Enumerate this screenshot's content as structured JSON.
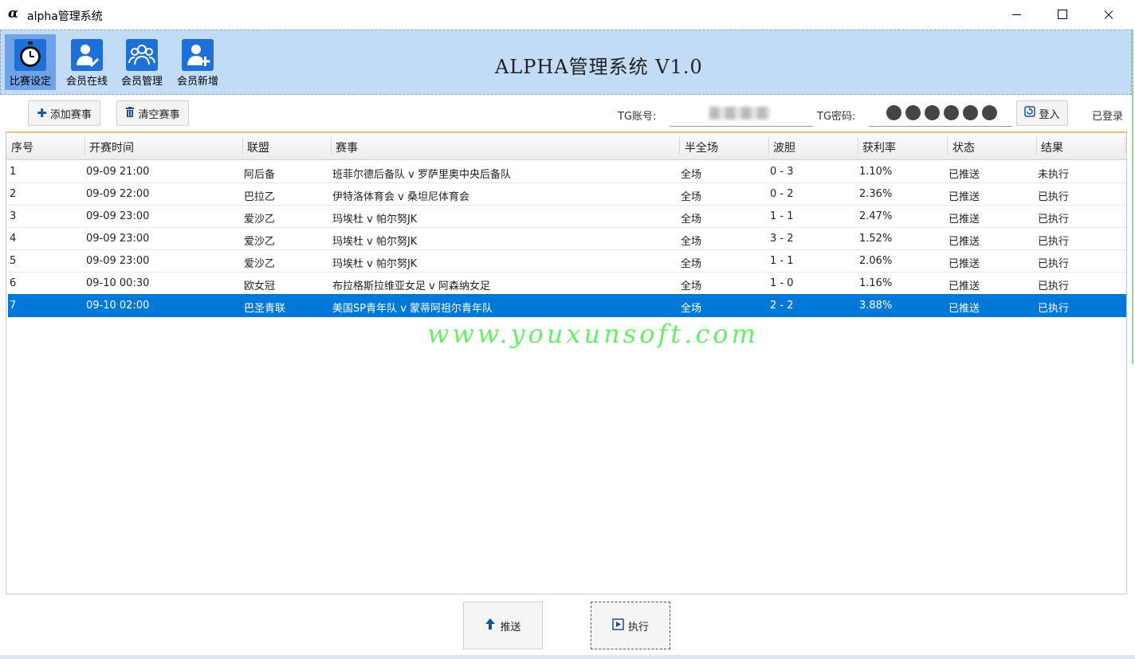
{
  "window": {
    "logo": "α",
    "title": "alpha管理系统"
  },
  "nav": [
    {
      "label": "比赛设定",
      "icon": "stopwatch-icon"
    },
    {
      "label": "会员在线",
      "icon": "user-check-icon"
    },
    {
      "label": "会员管理",
      "icon": "users-group-icon"
    },
    {
      "label": "会员新增",
      "icon": "user-add-icon"
    }
  ],
  "header": {
    "title": "ALPHA管理系统 V1.0"
  },
  "toolbar": {
    "add_label": "添加赛事",
    "clear_label": "清空赛事",
    "account_label": "TG账号:",
    "password_label": "TG密码:",
    "login_label": "登入",
    "status": "已登录"
  },
  "table": {
    "columns": [
      "序号",
      "开赛时间",
      "联盟",
      "赛事",
      "半全场",
      "波胆",
      "获利率",
      "状态",
      "结果"
    ],
    "rows": [
      [
        "1",
        "09-09 21:00",
        "阿后备",
        "班菲尔德后备队 v 罗萨里奥中央后备队",
        "全场",
        "0 - 3",
        "1.10%",
        "已推送",
        "未执行"
      ],
      [
        "2",
        "09-09 22:00",
        "巴拉乙",
        "伊特洛体育会 v 桑坦尼体育会",
        "全场",
        "0 - 2",
        "2.36%",
        "已推送",
        "已执行"
      ],
      [
        "3",
        "09-09 23:00",
        "爱沙乙",
        "玛埃杜 v 帕尔努JK",
        "全场",
        "1 - 1",
        "2.47%",
        "已推送",
        "已执行"
      ],
      [
        "4",
        "09-09 23:00",
        "爱沙乙",
        "玛埃杜 v 帕尔努JK",
        "全场",
        "3 - 2",
        "1.52%",
        "已推送",
        "已执行"
      ],
      [
        "5",
        "09-09 23:00",
        "爱沙乙",
        "玛埃杜 v 帕尔努JK",
        "全场",
        "1 - 1",
        "2.06%",
        "已推送",
        "已执行"
      ],
      [
        "6",
        "09-10 00:30",
        "欧女冠",
        "布拉格斯拉维亚女足 v 阿森纳女足",
        "全场",
        "1 - 0",
        "1.16%",
        "已推送",
        "已执行"
      ],
      [
        "7",
        "09-10 02:00",
        "巴圣青联",
        "美国SP青年队 v 蒙蒂阿祖尔青年队",
        "全场",
        "2 - 2",
        "3.88%",
        "已推送",
        "已执行"
      ]
    ],
    "selected_row": 7
  },
  "watermark": "www.youxunsoft.com",
  "actions": {
    "push_label": "推送",
    "execute_label": "执行"
  },
  "colors": {
    "header_bg": "#c2dcf8",
    "selection": "#0078d7",
    "watermark": "#66ee66"
  }
}
